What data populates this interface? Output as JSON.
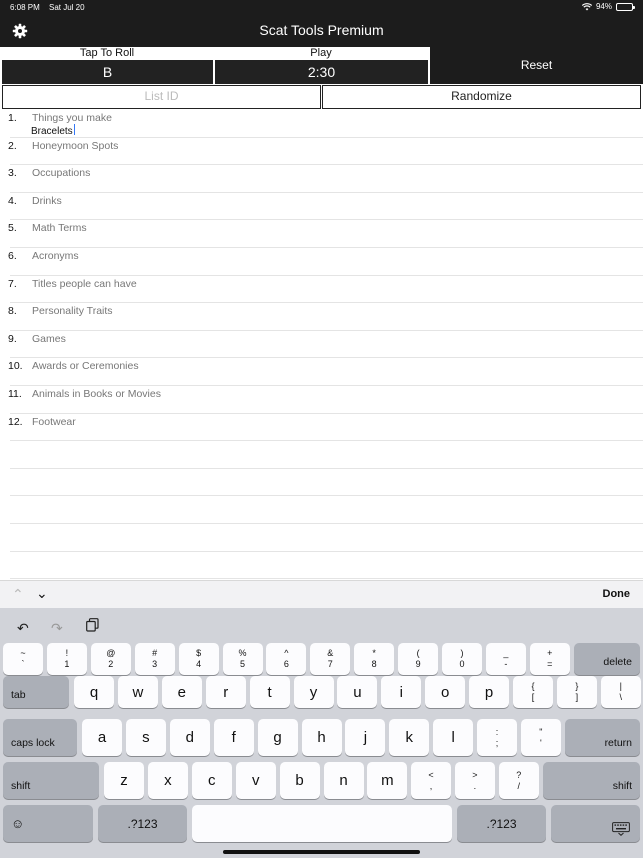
{
  "status": {
    "time": "6:08 PM",
    "date": "Sat Jul 20",
    "battery": "94%",
    "battery_level": 0.94
  },
  "app": {
    "title": "Scat Tools Premium",
    "settings_icon": "gear-icon"
  },
  "controls": {
    "roll_label": "Tap To Roll",
    "letter": "B",
    "play_label": "Play",
    "timer": "2:30",
    "reset": "Reset",
    "list_id_placeholder": "List ID",
    "randomize": "Randomize"
  },
  "list": [
    {
      "num": "1.",
      "category": "Things you make",
      "answer": "Bracelets"
    },
    {
      "num": "2.",
      "category": "Honeymoon Spots",
      "answer": ""
    },
    {
      "num": "3.",
      "category": "Occupations",
      "answer": ""
    },
    {
      "num": "4.",
      "category": "Drinks",
      "answer": ""
    },
    {
      "num": "5.",
      "category": "Math Terms",
      "answer": ""
    },
    {
      "num": "6.",
      "category": "Acronyms",
      "answer": ""
    },
    {
      "num": "7.",
      "category": "Titles people can have",
      "answer": ""
    },
    {
      "num": "8.",
      "category": "Personality Traits",
      "answer": ""
    },
    {
      "num": "9.",
      "category": "Games",
      "answer": ""
    },
    {
      "num": "10.",
      "category": "Awards or Ceremonies",
      "answer": ""
    },
    {
      "num": "11.",
      "category": "Animals in Books or Movies",
      "answer": ""
    },
    {
      "num": "12.",
      "category": "Footwear",
      "answer": ""
    }
  ],
  "accessory": {
    "done": "Done"
  },
  "keyboard": {
    "row1": [
      [
        "~",
        "`"
      ],
      [
        "!",
        "1"
      ],
      [
        "@",
        "2"
      ],
      [
        "#",
        "3"
      ],
      [
        "$",
        "4"
      ],
      [
        "%",
        "5"
      ],
      [
        "^",
        "6"
      ],
      [
        "&",
        "7"
      ],
      [
        "*",
        "8"
      ],
      [
        "(",
        "9"
      ],
      [
        ")",
        "0"
      ],
      [
        "_",
        "-"
      ],
      [
        "+",
        "="
      ]
    ],
    "delete": "delete",
    "tab": "tab",
    "row2": [
      "q",
      "w",
      "e",
      "r",
      "t",
      "y",
      "u",
      "i",
      "o",
      "p"
    ],
    "row2_sym": [
      [
        "{",
        "["
      ],
      [
        "}",
        "]"
      ],
      [
        "|",
        "\\"
      ]
    ],
    "caps": "caps lock",
    "row3": [
      "a",
      "s",
      "d",
      "f",
      "g",
      "h",
      "j",
      "k",
      "l"
    ],
    "row3_sym": [
      [
        ":",
        ";"
      ],
      [
        "\"",
        "'"
      ]
    ],
    "return": "return",
    "shift": "shift",
    "row4": [
      "z",
      "x",
      "c",
      "v",
      "b",
      "n",
      "m"
    ],
    "row4_sym": [
      [
        "<",
        ","
      ],
      [
        ">",
        "."
      ],
      [
        "?",
        "/"
      ]
    ],
    "numkey": ".?123"
  }
}
